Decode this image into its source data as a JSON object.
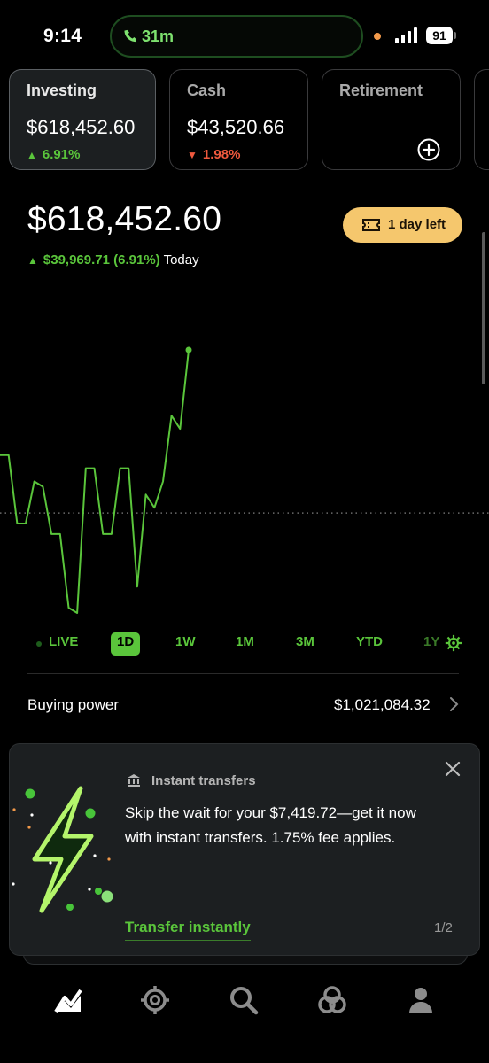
{
  "status_bar": {
    "time": "9:14",
    "call_duration": "31m",
    "battery": "91"
  },
  "accounts": [
    {
      "title": "Investing",
      "amount": "$618,452.60",
      "change": "6.91%",
      "direction": "up"
    },
    {
      "title": "Cash",
      "amount": "$43,520.66",
      "change": "1.98%",
      "direction": "down"
    },
    {
      "title": "Retirement"
    }
  ],
  "portfolio": {
    "value": "$618,452.60",
    "today_change": "$39,969.71 (6.91%)",
    "today_label": "Today",
    "promo_pill": "1 day left"
  },
  "chart_data": {
    "type": "line",
    "series": [
      {
        "values": [
          0.6,
          0.6,
          0.34,
          0.34,
          0.5,
          0.48,
          0.3,
          0.3,
          0.02,
          0.0,
          0.55,
          0.55,
          0.3,
          0.3,
          0.55,
          0.55,
          0.1,
          0.45,
          0.4,
          0.5,
          0.75,
          0.7,
          1.0
        ]
      }
    ],
    "baseline": 0.38,
    "colors": {
      "line": "#5ac53b",
      "baseline": "#6b6b6b"
    }
  },
  "ranges": {
    "items": [
      "LIVE",
      "1D",
      "1W",
      "1M",
      "3M",
      "YTD",
      "1Y"
    ],
    "selected": "1D"
  },
  "buying_power": {
    "label": "Buying power",
    "value": "$1,021,084.32"
  },
  "transfer_card": {
    "title": "Instant transfers",
    "body": "Skip the wait for your $7,419.72—get it now with instant transfers. 1.75% fee applies.",
    "cta": "Transfer instantly",
    "pager": "1/2"
  },
  "nav": {
    "items": [
      "investing-icon",
      "crypto-icon",
      "search-icon",
      "network-icon",
      "account-icon"
    ]
  },
  "colors": {
    "accent": "#5ac53b",
    "down": "#f0593e",
    "pill": "#f5c76d",
    "card": "#1c1f21"
  }
}
